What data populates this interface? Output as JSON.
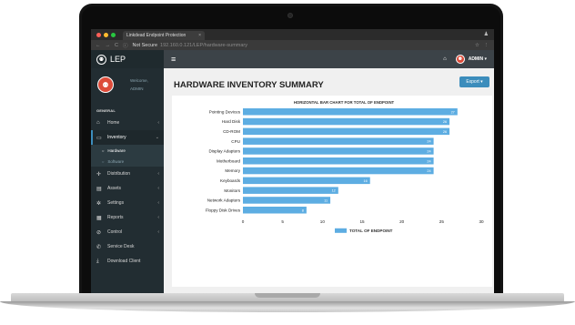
{
  "browser": {
    "tab_title": "Linkdead Endpoint Protection",
    "tab_close": "×",
    "not_secure": "Not Secure",
    "url": "192.160.0.121/LEP/hardware-summary",
    "nav_back": "←",
    "nav_forward": "→",
    "nav_reload": "C",
    "info_icon": "ⓘ",
    "star_icon": "☆",
    "menu_icon": "⋮",
    "profile_icon": "♟"
  },
  "app": {
    "logo_text": "LEP",
    "logo_glyph": "⚉",
    "menu_icon": "≡",
    "home_icon": "⌂",
    "admin_label": "ADMIN",
    "admin_caret": "▾",
    "admin_glyph": "⚉"
  },
  "user_panel": {
    "welcome": "Welcome,",
    "name": "ADMIN",
    "avatar_glyph": "⚉"
  },
  "sidebar": {
    "header": "GENERAL",
    "items": [
      {
        "label": "Home",
        "icon": "⌂",
        "caret": "‹"
      },
      {
        "label": "Inventory",
        "icon": "▭",
        "caret": "⌄"
      },
      {
        "label": "Distribution",
        "icon": "✛",
        "caret": "‹"
      },
      {
        "label": "Assets",
        "icon": "▤",
        "caret": "‹"
      },
      {
        "label": "Settings",
        "icon": "✲",
        "caret": "‹"
      },
      {
        "label": "Reports",
        "icon": "▦",
        "caret": "‹"
      },
      {
        "label": "Control",
        "icon": "⊘",
        "caret": "‹"
      },
      {
        "label": "Service Desk",
        "icon": "✆",
        "caret": ""
      },
      {
        "label": "Download Client",
        "icon": "⤓",
        "caret": ""
      }
    ],
    "subitems": [
      {
        "label": "Hardware",
        "bullet": "○"
      },
      {
        "label": "Software",
        "bullet": "○"
      }
    ]
  },
  "page": {
    "title": "HARDWARE INVENTORY SUMMARY",
    "export_label": "Export ▾"
  },
  "colors": {
    "bar": "#5dade2",
    "accent": "#3c8dbc",
    "sidebar_bg": "#222d32",
    "avatar": "#dd4b39"
  },
  "chart_data": {
    "type": "bar",
    "orientation": "horizontal",
    "title": "HORIZONTAL BAR CHART FOR TOTAL OF ENDPOINT",
    "categories": [
      "Pointing Devices",
      "Hard Disk",
      "CD-ROM",
      "CPU",
      "Display Adapters",
      "Motherboard",
      "Memory",
      "Keyboards",
      "Monitors",
      "Network Adapters",
      "Floppy Disk Drives"
    ],
    "series": [
      {
        "name": "TOTAL OF ENDPOINT",
        "values": [
          27,
          26,
          26,
          24,
          24,
          24,
          24,
          16,
          12,
          11,
          8
        ]
      }
    ],
    "xlim": [
      0,
      30
    ],
    "xticks": [
      "0",
      "5",
      "10",
      "15",
      "20",
      "25",
      "30"
    ],
    "legend": "bottom",
    "grid": false
  }
}
